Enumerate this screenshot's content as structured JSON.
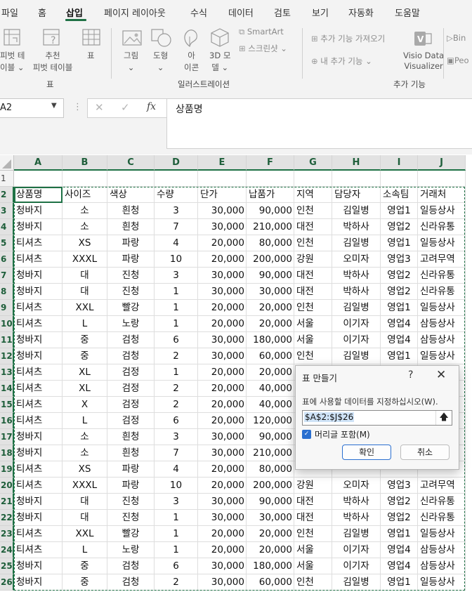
{
  "menu": {
    "tabs": [
      "파일",
      "홈",
      "삽입",
      "페이지 레이아웃",
      "수식",
      "데이터",
      "검토",
      "보기",
      "자동화",
      "도움말"
    ],
    "active_tab": "삽입"
  },
  "ribbon": {
    "pivot_label_1": "피벗 테",
    "pivot_label_2": "이블",
    "recpivot_label_1": "추천",
    "recpivot_label_2": "피벗 테이블",
    "table_label": "표",
    "pictures_label": "그림",
    "shapes_label": "도형",
    "icons_label_1": "아",
    "icons_label_2": "이콘",
    "model3d_label_1": "3D 모",
    "model3d_label_2": "델",
    "smartart_label": "SmartArt",
    "screenshot_label": "스크린샷",
    "get_addins_label": "추가 기능 가져오기",
    "my_addins_label": "내 추가 기능",
    "visio_label_1": "Visio Data",
    "visio_label_2": "Visualizer",
    "bing_label": "Bin",
    "people_label": "Peo",
    "group_tables": "표",
    "group_illustrations": "일러스트레이션",
    "group_addins": "추가 기능"
  },
  "formula_bar": {
    "name_box": "A2",
    "formula": "상품명"
  },
  "sheet": {
    "columns": [
      "A",
      "B",
      "C",
      "D",
      "E",
      "F",
      "G",
      "H",
      "I",
      "J"
    ],
    "row_numbers": [
      "1",
      "2",
      "3",
      "4",
      "5",
      "6",
      "7",
      "8",
      "9",
      "10",
      "11",
      "12",
      "13",
      "14",
      "15",
      "16",
      "17",
      "18",
      "19",
      "20",
      "21",
      "22",
      "23",
      "24",
      "25",
      "26"
    ],
    "headers": [
      "상품명",
      "사이즈",
      "색상",
      "수량",
      "단가",
      "납품가",
      "지역",
      "담당자",
      "소속팀",
      "거래처"
    ],
    "rows": [
      [
        "청바지",
        "소",
        "흰청",
        "3",
        "30,000",
        "90,000",
        "인천",
        "김일병",
        "영업1",
        "일등상사"
      ],
      [
        "청바지",
        "소",
        "흰청",
        "7",
        "30,000",
        "210,000",
        "대전",
        "박하사",
        "영업2",
        "신라유통"
      ],
      [
        "티셔츠",
        "XS",
        "파랑",
        "4",
        "20,000",
        "80,000",
        "인천",
        "김일병",
        "영업1",
        "일등상사"
      ],
      [
        "티셔츠",
        "XXXL",
        "파랑",
        "10",
        "20,000",
        "200,000",
        "강원",
        "오미자",
        "영업3",
        "고려무역"
      ],
      [
        "청바지",
        "대",
        "진청",
        "3",
        "30,000",
        "90,000",
        "대전",
        "박하사",
        "영업2",
        "신라유통"
      ],
      [
        "청바지",
        "대",
        "진청",
        "1",
        "30,000",
        "30,000",
        "대전",
        "박하사",
        "영업2",
        "신라유통"
      ],
      [
        "티셔츠",
        "XXL",
        "빨강",
        "1",
        "20,000",
        "20,000",
        "인천",
        "김일병",
        "영업1",
        "일등상사"
      ],
      [
        "티셔츠",
        "L",
        "노랑",
        "1",
        "20,000",
        "20,000",
        "서울",
        "이기자",
        "영업4",
        "삼등상사"
      ],
      [
        "청바지",
        "중",
        "검청",
        "6",
        "30,000",
        "180,000",
        "서울",
        "이기자",
        "영업4",
        "삼등상사"
      ],
      [
        "청바지",
        "중",
        "검청",
        "2",
        "30,000",
        "60,000",
        "인천",
        "김일병",
        "영업1",
        "일등상사"
      ],
      [
        "티셔츠",
        "XL",
        "검정",
        "1",
        "20,000",
        "20,000",
        "",
        "",
        "",
        ""
      ],
      [
        "티셔츠",
        "XL",
        "검정",
        "2",
        "20,000",
        "40,000",
        "",
        "",
        "",
        ""
      ],
      [
        "티셔츠",
        "X",
        "검정",
        "2",
        "20,000",
        "40,000",
        "",
        "",
        "",
        ""
      ],
      [
        "티셔츠",
        "L",
        "검정",
        "6",
        "20,000",
        "120,000",
        "",
        "",
        "",
        ""
      ],
      [
        "청바지",
        "소",
        "흰청",
        "3",
        "30,000",
        "90,000",
        "",
        "",
        "",
        ""
      ],
      [
        "청바지",
        "소",
        "흰청",
        "7",
        "30,000",
        "210,000",
        "",
        "",
        "",
        ""
      ],
      [
        "티셔츠",
        "XS",
        "파랑",
        "4",
        "20,000",
        "80,000",
        "",
        "",
        "",
        ""
      ],
      [
        "티셔츠",
        "XXXL",
        "파랑",
        "10",
        "20,000",
        "200,000",
        "강원",
        "오미자",
        "영업3",
        "고려무역"
      ],
      [
        "청바지",
        "대",
        "진청",
        "3",
        "30,000",
        "90,000",
        "대전",
        "박하사",
        "영업2",
        "신라유통"
      ],
      [
        "청바지",
        "대",
        "진청",
        "1",
        "30,000",
        "30,000",
        "대전",
        "박하사",
        "영업2",
        "신라유통"
      ],
      [
        "티셔츠",
        "XXL",
        "빨강",
        "1",
        "20,000",
        "20,000",
        "인천",
        "김일병",
        "영업1",
        "일등상사"
      ],
      [
        "티셔츠",
        "L",
        "노랑",
        "1",
        "20,000",
        "20,000",
        "서울",
        "이기자",
        "영업4",
        "삼등상사"
      ],
      [
        "청바지",
        "중",
        "검청",
        "6",
        "30,000",
        "180,000",
        "서울",
        "이기자",
        "영업4",
        "삼등상사"
      ],
      [
        "청바지",
        "중",
        "검청",
        "2",
        "30,000",
        "60,000",
        "인천",
        "김일병",
        "영업1",
        "일등상사"
      ]
    ]
  },
  "dialog": {
    "title": "표 만들기",
    "help": "?",
    "close": "✕",
    "prompt": "표에 사용할 데이터를 지정하십시오(W).",
    "range": "$A$2:$J$26",
    "checkbox_label": "머리글 포함(M)",
    "checkbox_checked": true,
    "ok": "확인",
    "cancel": "취소"
  },
  "colors": {
    "excel_green": "#1e7145",
    "dialog_accent": "#2a6fd0"
  }
}
